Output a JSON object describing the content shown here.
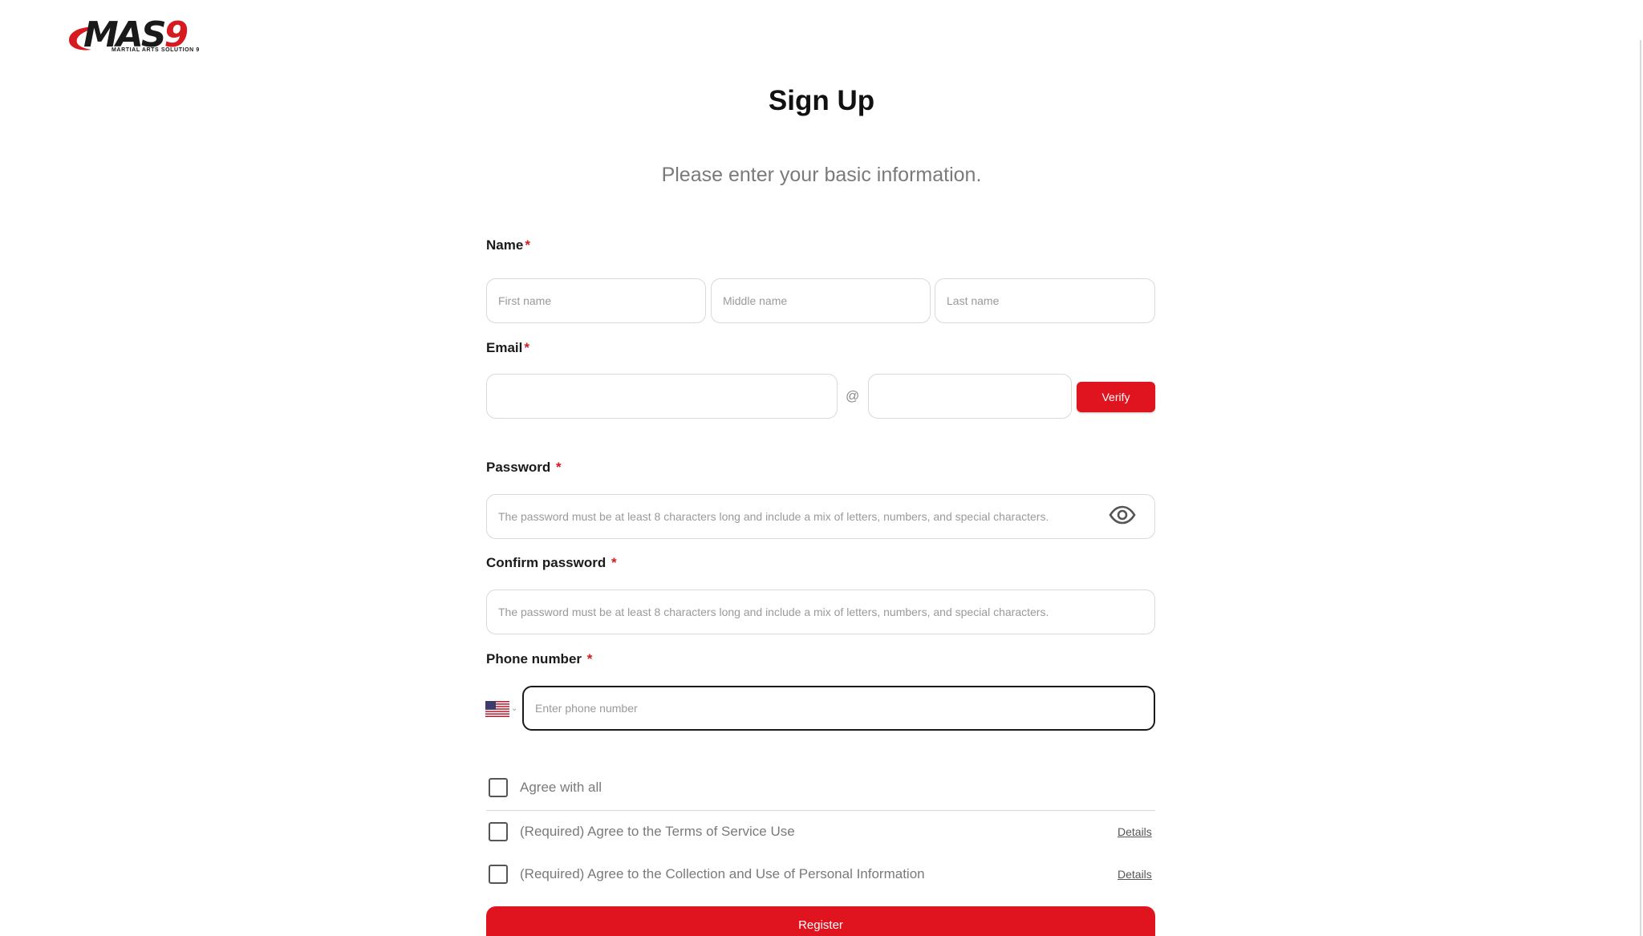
{
  "brand": {
    "logo_text_main": "MAS",
    "logo_text_accent": "9",
    "logo_subtitle": "MARTIAL ARTS SOLUTION 9",
    "accent_color": "#e0141e"
  },
  "header": {
    "title": "Sign Up",
    "subtitle": "Please enter your basic information."
  },
  "form": {
    "name": {
      "label": "Name",
      "required_mark": "*",
      "first_placeholder": "First name",
      "middle_placeholder": "Middle name",
      "last_placeholder": "Last name",
      "first_value": "",
      "middle_value": "",
      "last_value": ""
    },
    "email": {
      "label": "Email",
      "required_mark": "*",
      "local_value": "",
      "domain_value": "",
      "at_symbol": "@",
      "verify_label": "Verify"
    },
    "password": {
      "label": "Password",
      "required_mark": "*",
      "placeholder": "The password must be at least 8 characters long and include a mix of letters, numbers, and special characters.",
      "value": "",
      "toggle_icon": "eye-icon"
    },
    "confirm_password": {
      "label": "Confirm password",
      "required_mark": "*",
      "placeholder": "The password must be at least 8 characters long and include a mix of letters, numbers, and special characters.",
      "value": ""
    },
    "phone": {
      "label": "Phone number",
      "required_mark": "*",
      "country_icon": "us-flag-icon",
      "placeholder": "Enter phone number",
      "value": ""
    }
  },
  "agreements": {
    "all_label": "Agree with all",
    "terms_label": "(Required) Agree to the Terms of Service Use",
    "privacy_label": "(Required) Agree to the Collection and Use of Personal Information",
    "details_label": "Details"
  },
  "register_label": "Register"
}
